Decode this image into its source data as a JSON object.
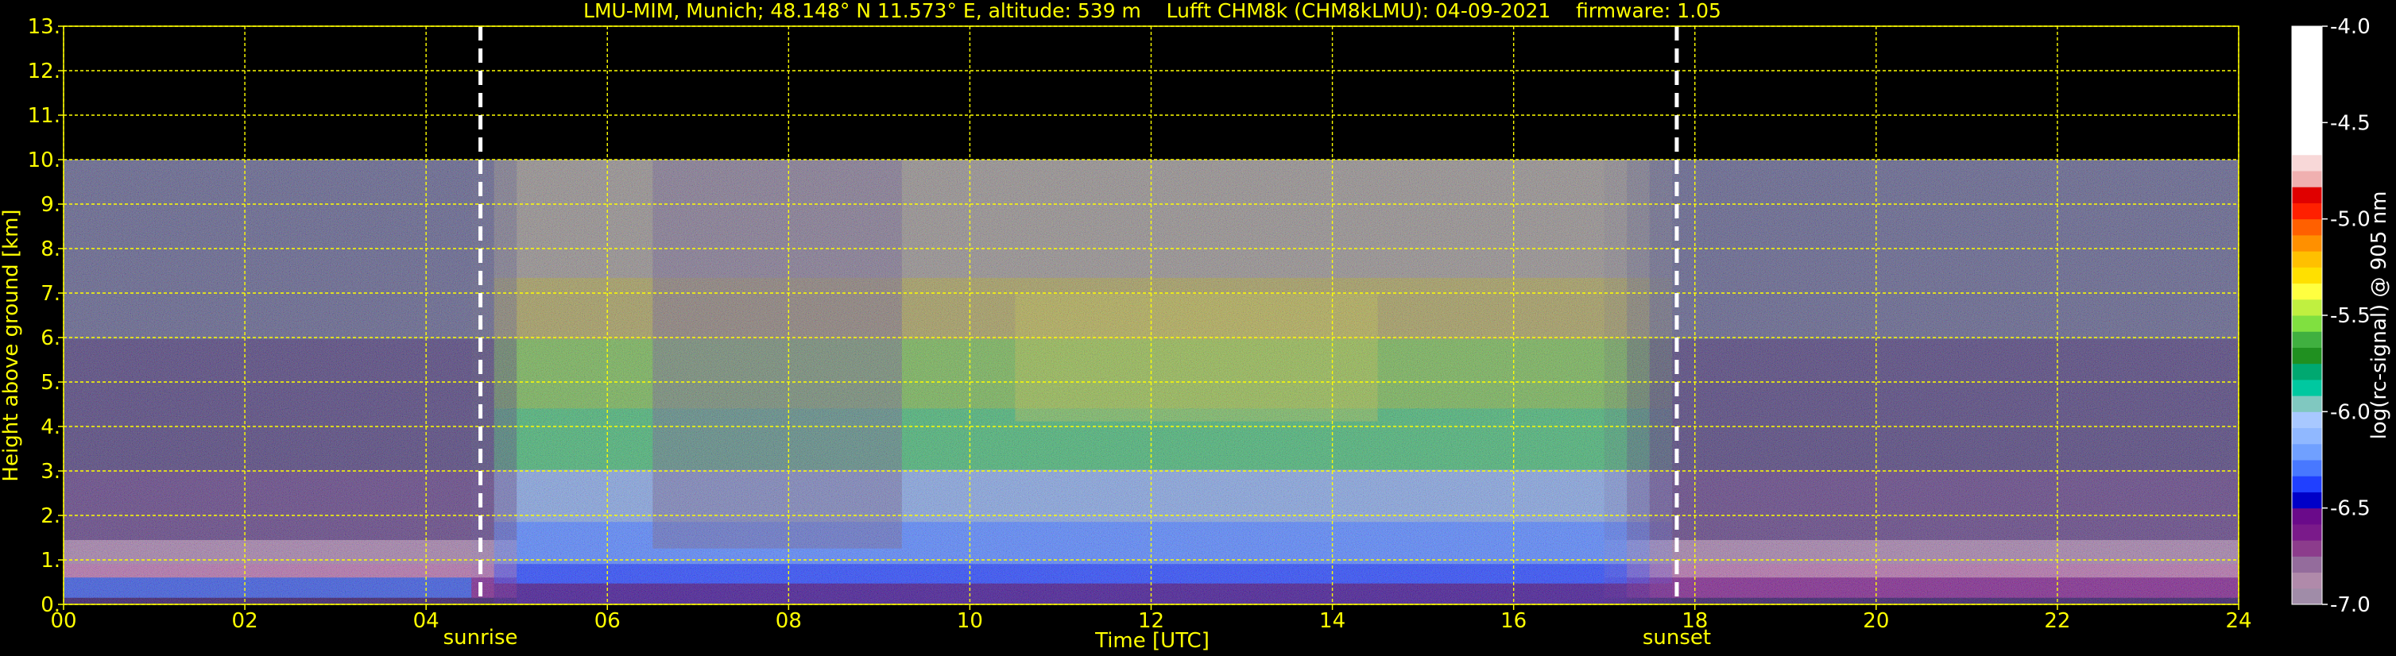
{
  "chart_data": {
    "type": "heatmap",
    "title": "LMU-MIM, Munich; 48.148° N 11.573° E, altitude: 539 m    Lufft CHM8k (CHM8kLMU): 04-09-2021    firmware: 1.05",
    "xlabel": "Time [UTC]",
    "ylabel": "Height above ground [km]",
    "xlim": [
      0,
      24
    ],
    "ylim": [
      0,
      13
    ],
    "x_ticks": [
      "00",
      "02",
      "04",
      "06",
      "08",
      "10",
      "12",
      "14",
      "16",
      "18",
      "20",
      "22",
      "24"
    ],
    "y_ticks": [
      "0.",
      "1.",
      "2.",
      "3.",
      "4.",
      "5.",
      "6.",
      "7.",
      "8.",
      "9.",
      "10.",
      "11.",
      "12.",
      "13."
    ],
    "grid": true,
    "data_ceiling_km": 10,
    "events": [
      {
        "name": "sunrise",
        "time": 4.6
      },
      {
        "name": "sunset",
        "time": 17.8
      }
    ],
    "colorbar": {
      "label": "log(rc-signal) @ 905 nm",
      "range": [
        -7.0,
        -4.0
      ],
      "ticks": [
        "-4.0",
        "-4.5",
        "-5.0",
        "-5.5",
        "-6.0",
        "-6.5",
        "-7.0"
      ],
      "colors": [
        "#a08ca8",
        "#b08aaa",
        "#946c9c",
        "#8c3c8c",
        "#7a1a8a",
        "#6a0a8a",
        "#0000c8",
        "#2040ff",
        "#4878ff",
        "#70a0ff",
        "#90b8ff",
        "#a8c8ff",
        "#80c8c0",
        "#00c8a0",
        "#00a870",
        "#209020",
        "#40b040",
        "#80e040",
        "#c0f040",
        "#ffff40",
        "#ffe000",
        "#ffc000",
        "#ff9000",
        "#ff6000",
        "#ff2000",
        "#e00000",
        "#f0b0b0",
        "#f8d8d8",
        "#ffffff",
        "#ffffff",
        "#ffffff",
        "#ffffff",
        "#ffffff",
        "#ffffff",
        "#ffffff",
        "#ffffff"
      ]
    }
  },
  "colors": {
    "axis_text": "#ffff00",
    "grid": "#ffff00",
    "background": "#000000"
  }
}
